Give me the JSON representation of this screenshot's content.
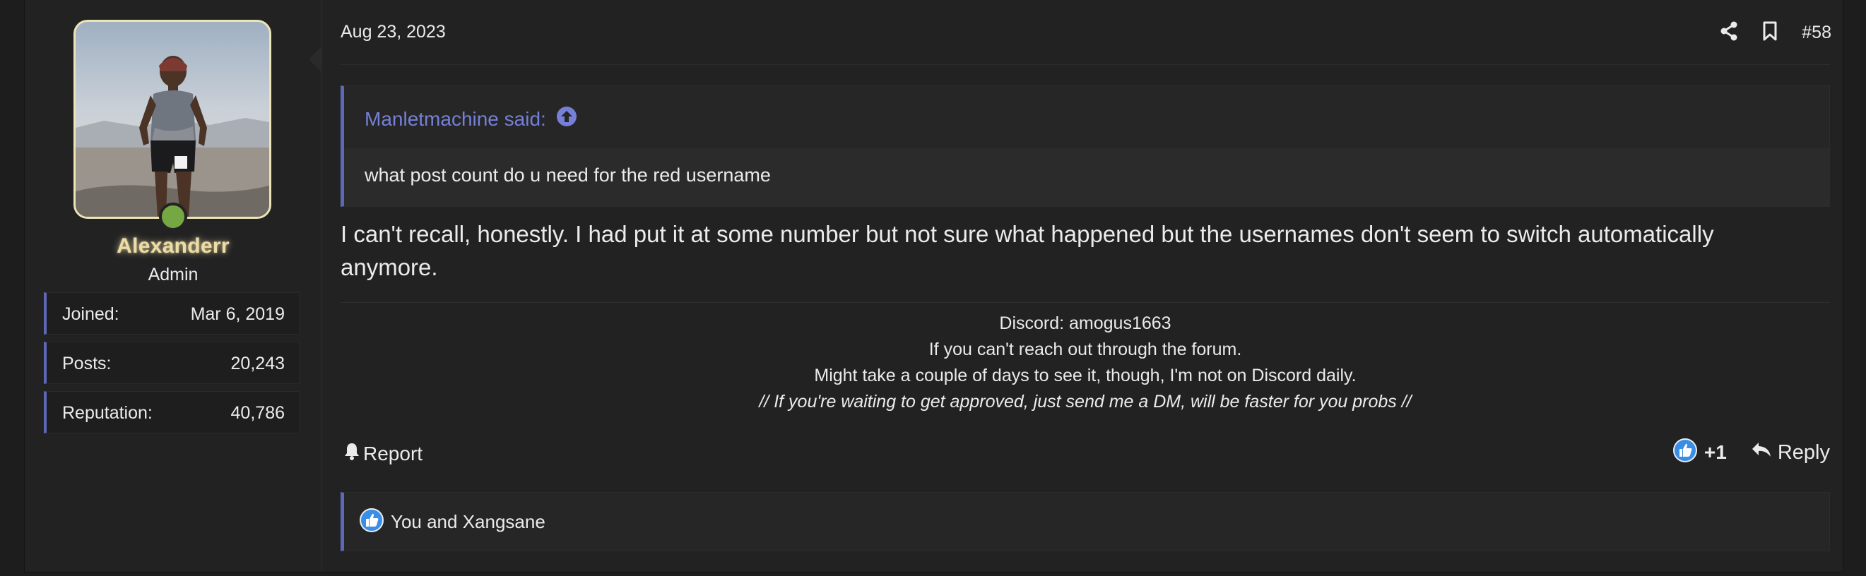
{
  "user": {
    "username": "Alexanderr",
    "title": "Admin",
    "online": true,
    "stats": [
      {
        "label": "Joined:",
        "value": "Mar 6, 2019"
      },
      {
        "label": "Posts:",
        "value": "20,243"
      },
      {
        "label": "Reputation:",
        "value": "40,786"
      }
    ]
  },
  "post": {
    "date": "Aug 23, 2023",
    "number": "#58",
    "share_icon": "share-icon",
    "bookmark_icon": "bookmark-icon"
  },
  "quote": {
    "author": "Manletmachine said:",
    "text": "what post count do u need for the red username"
  },
  "message": {
    "text": "I can't recall, honestly. I had put it at some number but not sure what happened but the usernames don't seem to switch automatically anymore."
  },
  "signature": {
    "lines": [
      "Discord: amogus1663",
      "If you can't reach out through the forum.",
      "Might take a couple of days to see it, though, I'm not on Discord daily.",
      "// If you're waiting to get approved, just send me a DM, will be faster for you probs //"
    ]
  },
  "actions": {
    "report_label": "Report",
    "reaction_count": "+1",
    "reply_label": "Reply"
  },
  "reactions": {
    "summary": "You and Xangsane"
  },
  "colors": {
    "accent": "#5d68b6",
    "quote_author": "#7580d6",
    "username_glow": "#ecdca6",
    "online": "#75a843",
    "like": "#3a8ee6"
  }
}
